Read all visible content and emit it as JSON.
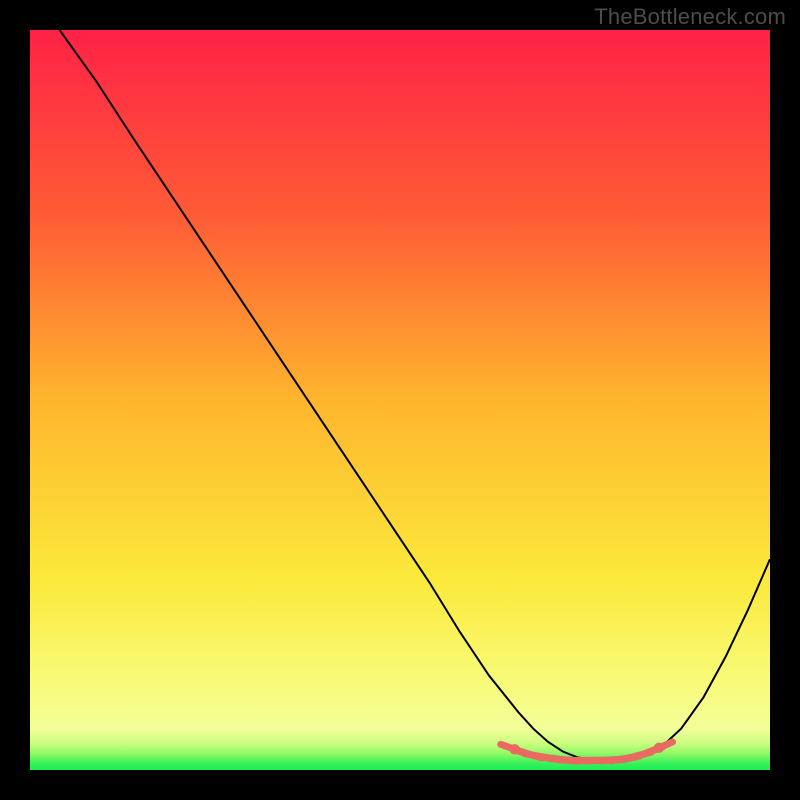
{
  "watermark": "TheBottleneck.com",
  "chart_data": {
    "type": "line",
    "title": "",
    "xlabel": "",
    "ylabel": "",
    "xlim": [
      0,
      100
    ],
    "ylim": [
      0,
      100
    ],
    "grid": false,
    "background": {
      "type": "gradient-vertical",
      "stops": [
        {
          "offset": 0.0,
          "color": "#ff2246"
        },
        {
          "offset": 0.25,
          "color": "#ff5b36"
        },
        {
          "offset": 0.5,
          "color": "#ffb52d"
        },
        {
          "offset": 0.74,
          "color": "#fbe93b"
        },
        {
          "offset": 0.88,
          "color": "#f8fb78"
        },
        {
          "offset": 0.945,
          "color": "#f3fe99"
        },
        {
          "offset": 0.965,
          "color": "#c7fd7e"
        },
        {
          "offset": 0.978,
          "color": "#8ff966"
        },
        {
          "offset": 0.99,
          "color": "#3ef25b"
        },
        {
          "offset": 1.0,
          "color": "#17ef58"
        }
      ]
    },
    "series": [
      {
        "name": "curve",
        "color": "#000000",
        "x": [
          4,
          9,
          14,
          19,
          24,
          29,
          34,
          39,
          44,
          49,
          54,
          58,
          62,
          66,
          68,
          70,
          72,
          74,
          77,
          80,
          82,
          85,
          88,
          91,
          94,
          97,
          100
        ],
        "y": [
          100,
          93,
          85.3,
          77.8,
          70.3,
          62.8,
          55.3,
          47.8,
          40.3,
          32.8,
          25.3,
          18.8,
          12.8,
          7.8,
          5.6,
          3.8,
          2.5,
          1.7,
          1.2,
          1.2,
          1.5,
          2.8,
          5.6,
          9.8,
          15.3,
          21.6,
          28.5
        ]
      }
    ],
    "markers": {
      "name": "dash-band",
      "color": "#e96a60",
      "radius": 1.0,
      "points": [
        {
          "x": 65.5,
          "y": 2.8
        },
        {
          "x": 67.2,
          "y": 2.2
        },
        {
          "x": 68.8,
          "y": 1.85
        },
        {
          "x": 70.4,
          "y": 1.6
        },
        {
          "x": 72.0,
          "y": 1.4
        },
        {
          "x": 73.4,
          "y": 1.3
        },
        {
          "x": 74.8,
          "y": 1.3
        },
        {
          "x": 76.2,
          "y": 1.3
        },
        {
          "x": 77.6,
          "y": 1.32
        },
        {
          "x": 79.0,
          "y": 1.4
        },
        {
          "x": 80.4,
          "y": 1.55
        },
        {
          "x": 82.0,
          "y": 1.9
        },
        {
          "x": 83.6,
          "y": 2.4
        },
        {
          "x": 85.0,
          "y": 3.0
        }
      ]
    }
  }
}
